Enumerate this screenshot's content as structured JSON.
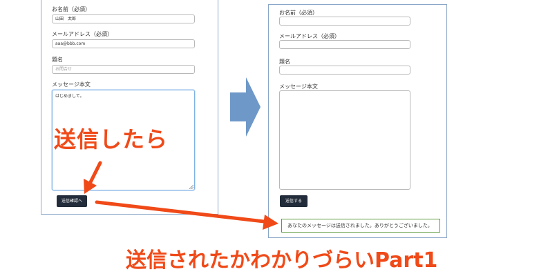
{
  "left_form": {
    "name_label": "お名前（必須）",
    "name_value": "山田　太郎",
    "email_label": "メールアドレス（必須）",
    "email_value": "aaa@bbb.com",
    "subject_label": "題名",
    "subject_placeholder": "お問合せ",
    "message_label": "メッセージ本文",
    "message_value": "はじめまして。",
    "submit_label": "送信確認へ"
  },
  "right_form": {
    "name_label": "お名前（必須）",
    "email_label": "メールアドレス（必須）",
    "subject_label": "題名",
    "message_label": "メッセージ本文",
    "submit_label": "送信する",
    "success_message": "あなたのメッセージは送信されました。ありがとうございました。"
  },
  "annotations": {
    "after_submit": "送信したら",
    "caption": "送信されたかわかりづらいPart1"
  },
  "colors": {
    "annotation_red": "#f04a18",
    "flow_arrow_blue": "#6e98c8",
    "button_dark": "#222c3a",
    "success_border": "#5a9a3a"
  }
}
